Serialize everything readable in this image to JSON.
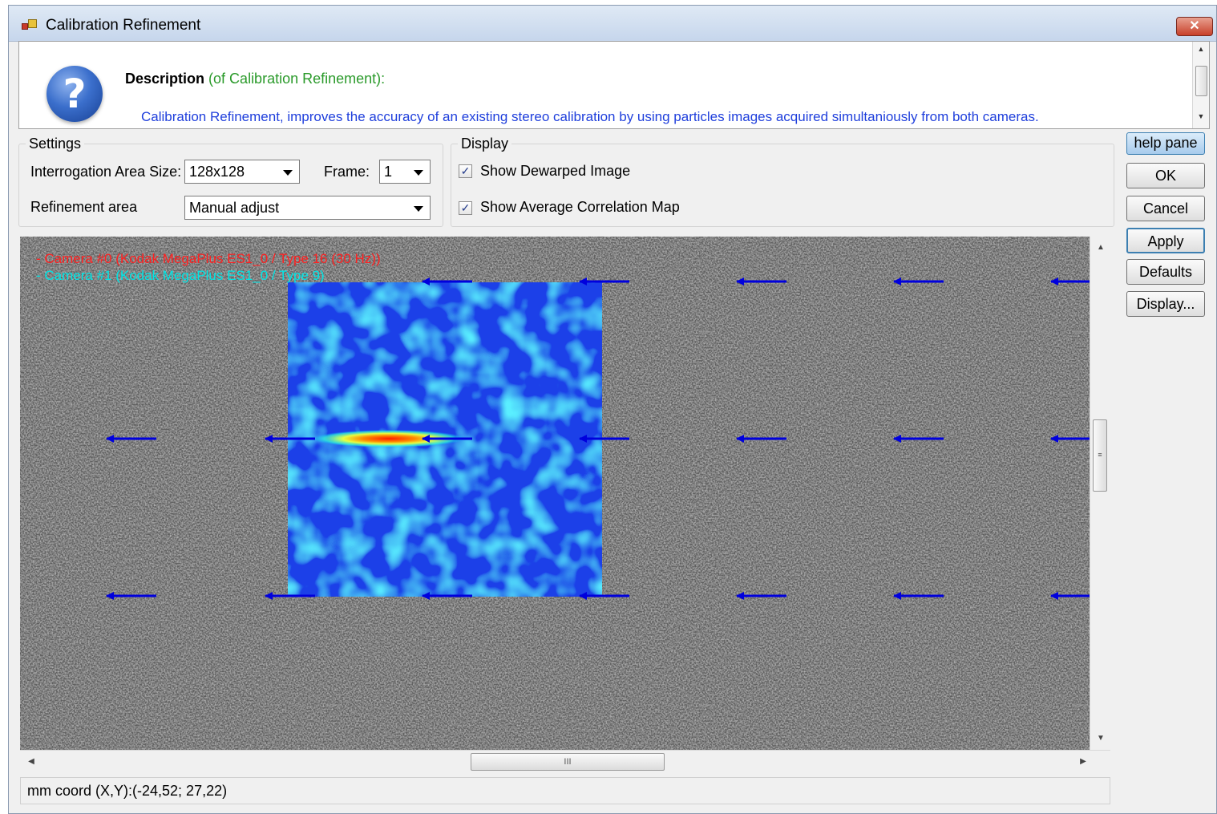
{
  "window": {
    "title": "Calibration Refinement",
    "close_glyph": "✕",
    "app_icon": "app-icon"
  },
  "description": {
    "icon": "help-icon",
    "icon_glyph": "?",
    "heading": "Description",
    "heading_sub": "(of Calibration Refinement):",
    "text": "Calibration Refinement, improves the accuracy of an existing stereo calibration by using particles images acquired simultaniously from both cameras."
  },
  "settings": {
    "title": "Settings",
    "ia_size_label": "Interrogation Area Size:",
    "ia_size_value": "128x128",
    "frame_label": "Frame:",
    "frame_value": "1",
    "refinement_label": "Refinement area",
    "refinement_value": "Manual adjust"
  },
  "display": {
    "title": "Display",
    "show_dewarped_label": "Show Dewarped Image",
    "show_dewarped_checked": true,
    "show_avg_corr_label": "Show Average Correlation Map",
    "show_avg_corr_checked": true
  },
  "buttons": {
    "help_pane": "help pane",
    "ok": "OK",
    "cancel": "Cancel",
    "apply": "Apply",
    "defaults": "Defaults",
    "display": "Display..."
  },
  "view": {
    "camera0_label": "- Camera #0 (Kodak MegaPlus ES1_0 / Type 16 (30 Hz))",
    "camera1_label": "- Camera #1 (Kodak MegaPlus ES1_0 / Type 9)",
    "camera0_color": "#ff2020",
    "camera1_color": "#00e5e5",
    "vector_color": "#0000dd"
  },
  "scrollbars": {
    "v_grip": "≡",
    "h_grip": "III",
    "up": "▲",
    "down": "▼",
    "left": "◀",
    "right": "▶"
  },
  "status": {
    "coord_text": "mm coord (X,Y):(-24,52; 27,22)"
  }
}
